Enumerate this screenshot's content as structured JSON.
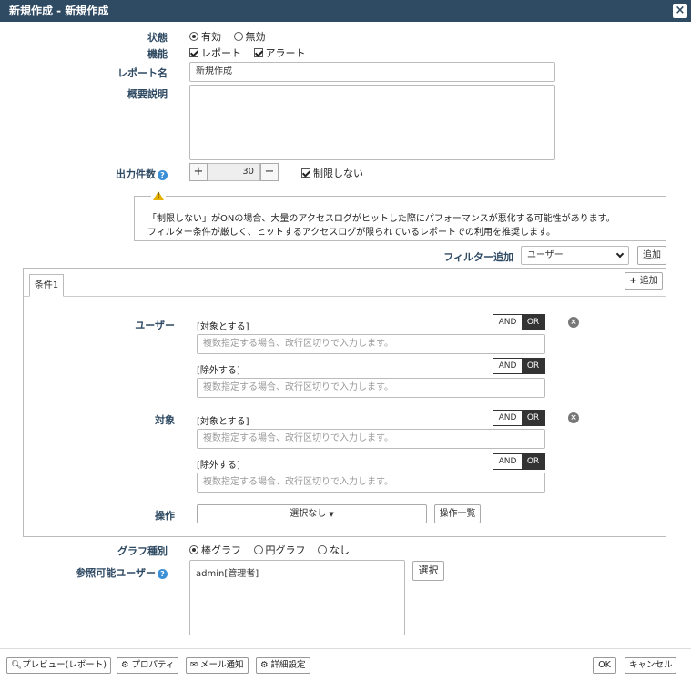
{
  "window": {
    "title": "新規作成 - 新規作成",
    "close_label": "×"
  },
  "form": {
    "state": {
      "label": "状態",
      "options": [
        "有効",
        "無効"
      ],
      "selected": "有効"
    },
    "function": {
      "label": "機能",
      "options": [
        {
          "label": "レポート",
          "checked": true
        },
        {
          "label": "アラート",
          "checked": true
        }
      ]
    },
    "report_name": {
      "label": "レポート名",
      "value": "新規作成"
    },
    "description": {
      "label": "概要説明",
      "value": ""
    },
    "output_count": {
      "label": "出力件数",
      "help": "?",
      "value": "30",
      "plus": "+",
      "minus": "−",
      "unlimited_label": "制限しない",
      "unlimited_checked": true
    },
    "warning": {
      "line1": "「制限しない」がONの場合、大量のアクセスログがヒットした際にパフォーマンスが悪化する可能性があります。",
      "line2": "フィルター条件が厳しく、ヒットするアクセスログが限られているレポートでの利用を推奨します。"
    },
    "filter_add": {
      "label": "フィルター追加",
      "selected": "ユーザー",
      "add_button": "追加"
    }
  },
  "conditions": {
    "tab_label": "条件1",
    "add_button": "追加",
    "groups": [
      {
        "label": "ユーザー",
        "include_label": "[対象とする]",
        "exclude_label": "[除外する]",
        "placeholder": "複数指定する場合、改行区切りで入力します。",
        "and": "AND",
        "or": "OR"
      },
      {
        "label": "対象",
        "include_label": "[対象とする]",
        "exclude_label": "[除外する]",
        "placeholder": "複数指定する場合、改行区切りで入力します。",
        "and": "AND",
        "or": "OR"
      }
    ],
    "operation": {
      "label": "操作",
      "selected": "選択なし",
      "list_button": "操作一覧"
    }
  },
  "graph": {
    "label": "グラフ種別",
    "options": [
      "棒グラフ",
      "円グラフ",
      "なし"
    ],
    "selected": "棒グラフ"
  },
  "viewers": {
    "label": "参照可能ユーザー",
    "help": "?",
    "value": "admin[管理者]",
    "select_button": "選択"
  },
  "footer": {
    "preview": "プレビュー(レポート)",
    "property": "プロパティ",
    "mail": "メール通知",
    "detail": "詳細設定",
    "ok": "OK",
    "cancel": "キャンセル"
  },
  "colors": {
    "title_bg": "#2f4a63",
    "label": "#2f4a63",
    "help": "#3a8fd6",
    "warning": "#e5b000"
  }
}
